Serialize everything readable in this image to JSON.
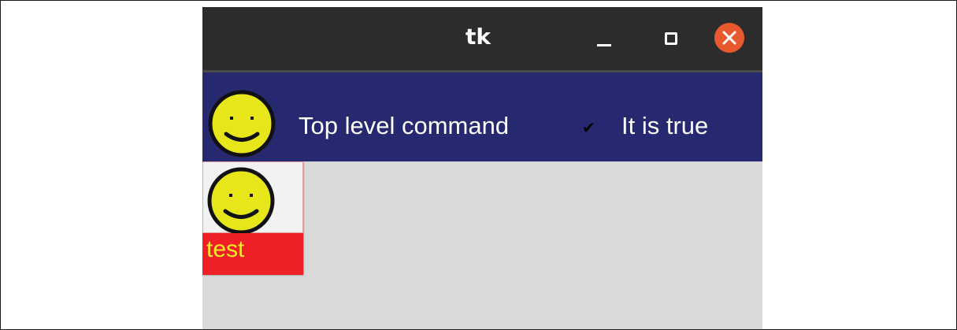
{
  "window": {
    "title": "tk",
    "controls": {
      "minimize_icon": "minimize-icon",
      "maximize_icon": "maximize-icon",
      "close_icon": "close-icon"
    }
  },
  "menubar": {
    "image_icon": "smiley-icon",
    "command_label": "Top level command",
    "check_item": {
      "label": "It is true",
      "checked": true,
      "mark": "✔"
    }
  },
  "button": {
    "image_icon": "smiley-icon",
    "label": "test"
  },
  "colors": {
    "titlebar": "#2c2c2c",
    "menubar_bg": "#262970",
    "window_bg": "#d9d9d9",
    "close_button": "#e9592f",
    "button_bg": "#ee1f25",
    "button_text": "#f5ea2a",
    "smiley_fill": "#e6e61a"
  }
}
